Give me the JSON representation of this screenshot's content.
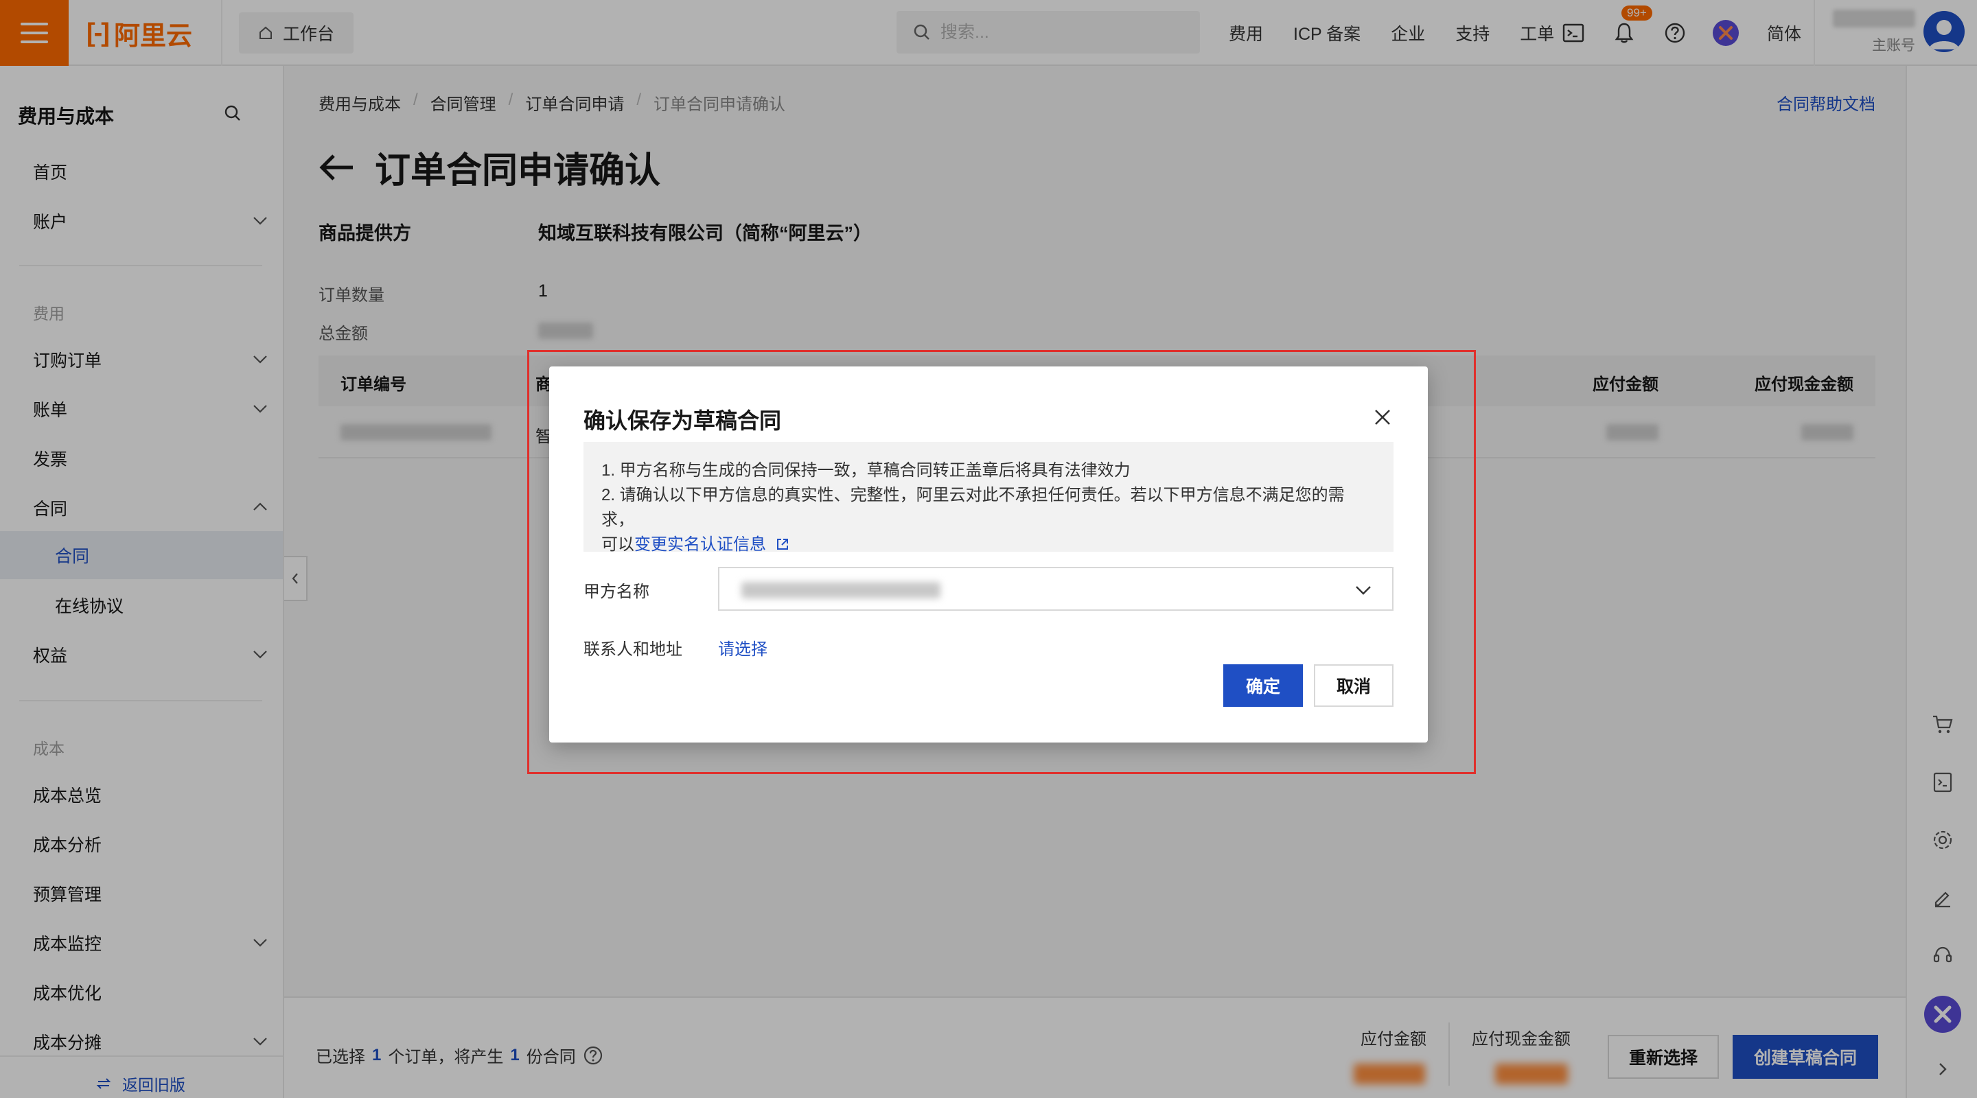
{
  "header": {
    "logo_text": "阿里云",
    "logo_mark": "[-]",
    "workbench_label": "工作台",
    "search_placeholder": "搜索...",
    "nav": [
      "费用",
      "ICP 备案",
      "企业",
      "支持",
      "工单"
    ],
    "notification_badge": "99+",
    "language": "简体",
    "account_role": "主账号",
    "brand_color": "#ff6a00"
  },
  "sidebar": {
    "title": "费用与成本",
    "items": {
      "home": "首页",
      "account": "账户",
      "group_fee": "费用",
      "orders": "订购订单",
      "bills": "账单",
      "invoice": "发票",
      "contract": "合同",
      "contract_sub": "合同",
      "online_agreement": "在线协议",
      "rights": "权益",
      "group_cost": "成本",
      "cost_overview": "成本总览",
      "cost_analysis": "成本分析",
      "budget": "预算管理",
      "cost_monitor": "成本监控",
      "cost_optimize": "成本优化",
      "cost_allocation": "成本分摊"
    },
    "back_label": "返回旧版"
  },
  "main": {
    "breadcrumb": [
      "费用与成本",
      "合同管理",
      "订单合同申请",
      "订单合同申请确认"
    ],
    "help_link": "合同帮助文档",
    "page_title": "订单合同申请确认",
    "provider_label": "商品提供方",
    "provider_value": "知域互联科技有限公司（简称“阿里云”）",
    "order_count_label": "订单数量",
    "order_count_value": "1",
    "total_label": "总金额",
    "table": {
      "headers": {
        "order_no": "订单编号",
        "product": "商",
        "payable": "应付金额",
        "cash_payable": "应付现金金额"
      },
      "row_product_prefix": "智"
    }
  },
  "bottom": {
    "summary_prefix": "已选择",
    "summary_count1": "1",
    "summary_mid": "个订单，将产生",
    "summary_count2": "1",
    "summary_suffix": "份合同",
    "payable_label": "应付金额",
    "cash_payable_label": "应付现金金额",
    "reselect_label": "重新选择",
    "create_label": "创建草稿合同"
  },
  "modal": {
    "title": "确认保存为草稿合同",
    "notice_line1": "1. 甲方名称与生成的合同保持一致，草稿合同转正盖章后将具有法律效力",
    "notice_line2": "2. 请确认以下甲方信息的真实性、完整性，阿里云对此不承担任何责任。若以下甲方信息不满足您的需求，",
    "notice_line3_prefix": "可以",
    "notice_link": "变更实名认证信息",
    "party_a_label": "甲方名称",
    "contact_label": "联系人和地址",
    "choose_link": "请选择",
    "ok_label": "确定",
    "cancel_label": "取消"
  }
}
